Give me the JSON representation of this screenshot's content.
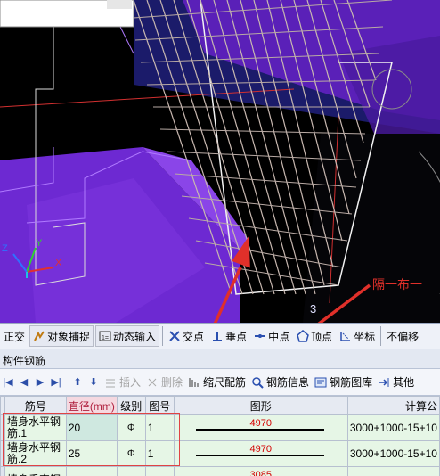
{
  "viewport": {
    "annotation_text": "隔一布一",
    "axis_labels": {
      "x": "X",
      "y": "Y",
      "z": "Z"
    },
    "small_label": "3"
  },
  "snap_toolbar": {
    "items": [
      {
        "label": "正交",
        "icon": "ortho-icon"
      },
      {
        "label": "对象捕捉",
        "icon": "object-snap-icon"
      },
      {
        "label": "动态输入",
        "icon": "dynamic-input-icon"
      },
      {
        "label": "交点",
        "icon": "intersection-icon"
      },
      {
        "label": "垂点",
        "icon": "perpendicular-icon"
      },
      {
        "label": "中点",
        "icon": "midpoint-icon"
      },
      {
        "label": "顶点",
        "icon": "vertex-icon"
      },
      {
        "label": "坐标",
        "icon": "coordinate-icon"
      },
      {
        "label": "不偏移",
        "icon": ""
      }
    ]
  },
  "panel": {
    "title": "构件钢筋"
  },
  "rebar_toolbar": {
    "insert": "插入",
    "delete": "删除",
    "scale": "缩尺配筋",
    "info": "钢筋信息",
    "library": "钢筋图库",
    "other": "其他"
  },
  "table": {
    "headers": {
      "no": "筋号",
      "diameter": "直径(mm)",
      "grade": "级别",
      "fig": "图号",
      "shape": "图形",
      "formula": "计算公"
    },
    "rows": [
      {
        "name": "墙身水平钢筋.1",
        "diameter": "20",
        "grade": "Φ",
        "fig": "1",
        "shape_value": "4970",
        "formula": "3000+1000-15+10"
      },
      {
        "name": "墙身水平钢筋.2",
        "diameter": "25",
        "grade": "Φ",
        "fig": "1",
        "shape_value": "4970",
        "formula": "3000+1000-15+10"
      },
      {
        "name": "墙身垂直钢",
        "diameter": "",
        "grade": "",
        "fig": "",
        "shape_value": "3085",
        "formula": ""
      }
    ]
  },
  "colors": {
    "purple": "#7b2ee0",
    "rebar": "#c8b8b0",
    "annotation_red": "#e0302a"
  }
}
